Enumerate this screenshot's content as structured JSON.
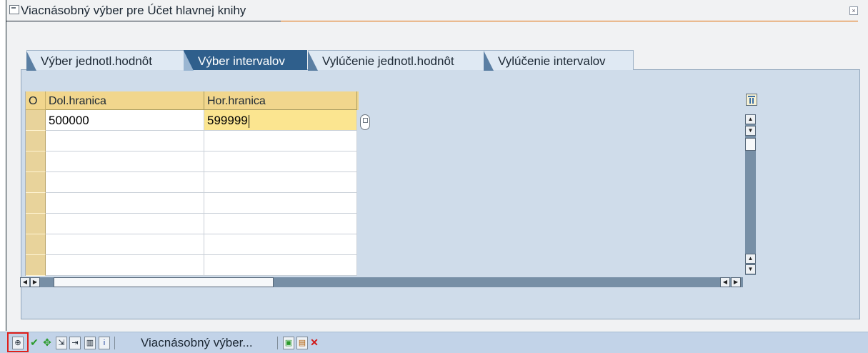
{
  "dialog": {
    "title": "Viacnásobný výber pre Účet hlavnej knihy"
  },
  "tabs": [
    {
      "label": "Výber jednotl.hodnôt",
      "active": false
    },
    {
      "label": "Výber intervalov",
      "active": true
    },
    {
      "label": "Vylúčenie jednotl.hodnôt",
      "active": false
    },
    {
      "label": "Vylúčenie intervalov",
      "active": false
    }
  ],
  "table": {
    "columns": [
      "O",
      "Dol.hranica",
      "Hor.hranica"
    ],
    "rows": [
      {
        "lower": "500000",
        "upper": "599999"
      },
      {
        "lower": "",
        "upper": ""
      },
      {
        "lower": "",
        "upper": ""
      },
      {
        "lower": "",
        "upper": ""
      },
      {
        "lower": "",
        "upper": ""
      },
      {
        "lower": "",
        "upper": ""
      },
      {
        "lower": "",
        "upper": ""
      },
      {
        "lower": "",
        "upper": ""
      }
    ]
  },
  "toolbar": {
    "label": "Viacnásobný výber...",
    "icons": [
      "execute-icon",
      "check-icon",
      "insert-line-icon",
      "import-file-icon",
      "upload-clipboard-icon",
      "delete-icon",
      "info-icon",
      "paste-icon",
      "copy-icon",
      "cancel-icon"
    ]
  },
  "colors": {
    "active_tab": "#2f5f8c",
    "toolbar_bg": "#c2d3e8",
    "focus_cell": "#fbe590",
    "highlight_frame": "#e0201c"
  }
}
